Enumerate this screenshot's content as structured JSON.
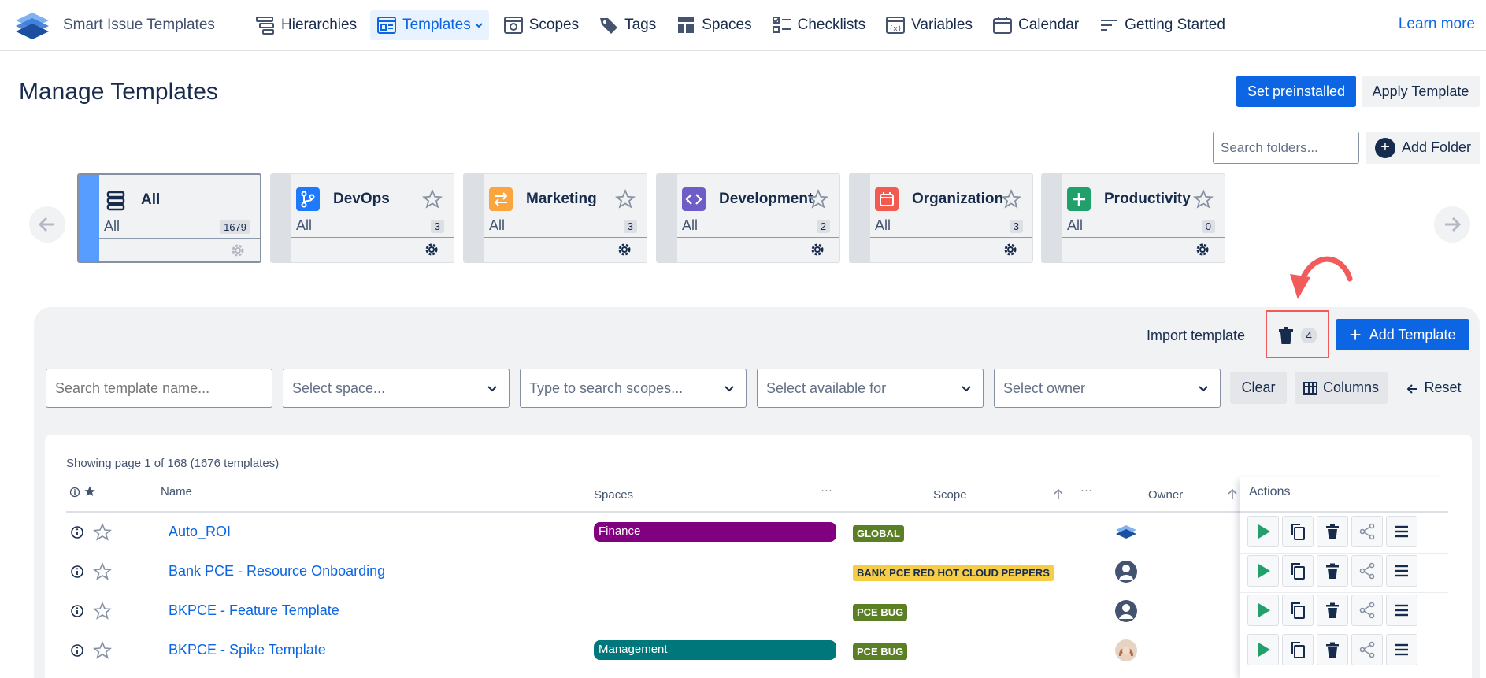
{
  "brand": {
    "name": "Smart Issue Templates"
  },
  "nav": {
    "items": [
      {
        "label": "Hierarchies",
        "icon": "hierarchy-icon"
      },
      {
        "label": "Templates",
        "icon": "templates-icon",
        "active": true
      },
      {
        "label": "Scopes",
        "icon": "scopes-icon"
      },
      {
        "label": "Tags",
        "icon": "tag-icon"
      },
      {
        "label": "Spaces",
        "icon": "spaces-icon"
      },
      {
        "label": "Checklists",
        "icon": "checklist-icon"
      },
      {
        "label": "Variables",
        "icon": "variables-icon"
      },
      {
        "label": "Calendar",
        "icon": "calendar-icon"
      },
      {
        "label": "Getting Started",
        "icon": "getting-started-icon"
      }
    ],
    "learn_more": "Learn more"
  },
  "header": {
    "title": "Manage Templates",
    "set_preinstalled": "Set preinstalled",
    "apply_template": "Apply Template",
    "folder_search_placeholder": "Search folders...",
    "add_folder": "Add Folder"
  },
  "folders": [
    {
      "title": "All",
      "sub": "All",
      "count": "1679",
      "color": "",
      "icon": "stack-icon",
      "selected": true
    },
    {
      "title": "DevOps",
      "sub": "All",
      "count": "3",
      "color": "#1d7afc",
      "icon": "branch-icon"
    },
    {
      "title": "Marketing",
      "sub": "All",
      "count": "3",
      "color": "#faa53d",
      "icon": "swap-icon"
    },
    {
      "title": "Development",
      "sub": "All",
      "count": "2",
      "color": "#6e5dc6",
      "icon": "code-icon"
    },
    {
      "title": "Organization",
      "sub": "All",
      "count": "3",
      "color": "#f15b50",
      "icon": "calendar-icon"
    },
    {
      "title": "Productivity",
      "sub": "All",
      "count": "0",
      "color": "#22a06b",
      "icon": "plus-icon"
    }
  ],
  "toolbar": {
    "import_template": "Import template",
    "trash_count": "4",
    "add_template": "Add Template"
  },
  "filters": {
    "search_placeholder": "Search template name...",
    "space_placeholder": "Select space...",
    "scopes_placeholder": "Type to search scopes...",
    "available_placeholder": "Select available for",
    "owner_placeholder": "Select owner",
    "clear": "Clear",
    "columns": "Columns",
    "reset": "Reset"
  },
  "table": {
    "showing": "Showing page 1 of 168 (1676 templates)",
    "headers": {
      "name": "Name",
      "spaces": "Spaces",
      "scope": "Scope",
      "owner": "Owner",
      "actions": "Actions",
      "more": "···"
    },
    "rows": [
      {
        "name": "Auto_ROI",
        "space": "Finance",
        "space_color": "#800080",
        "scope": "GLOBAL",
        "scope_bg": "#5b7f24",
        "scope_fg": "#ffffff",
        "owner": "app-logo"
      },
      {
        "name": "Bank PCE - Resource Onboarding",
        "space": "",
        "space_color": "",
        "scope": "BANK PCE RED HOT CLOUD PEPPERS",
        "scope_bg": "#f5cd47",
        "scope_fg": "#172b4d",
        "owner": "user-avatar"
      },
      {
        "name": "BKPCE - Feature Template",
        "space": "",
        "space_color": "",
        "scope": "PCE BUG",
        "scope_bg": "#5b7f24",
        "scope_fg": "#ffffff",
        "owner": "user-avatar"
      },
      {
        "name": "BKPCE - Spike Template",
        "space": "Management",
        "space_color": "#00777b",
        "scope": "PCE BUG",
        "scope_bg": "#5b7f24",
        "scope_fg": "#ffffff",
        "owner": "photo-avatar"
      }
    ]
  }
}
